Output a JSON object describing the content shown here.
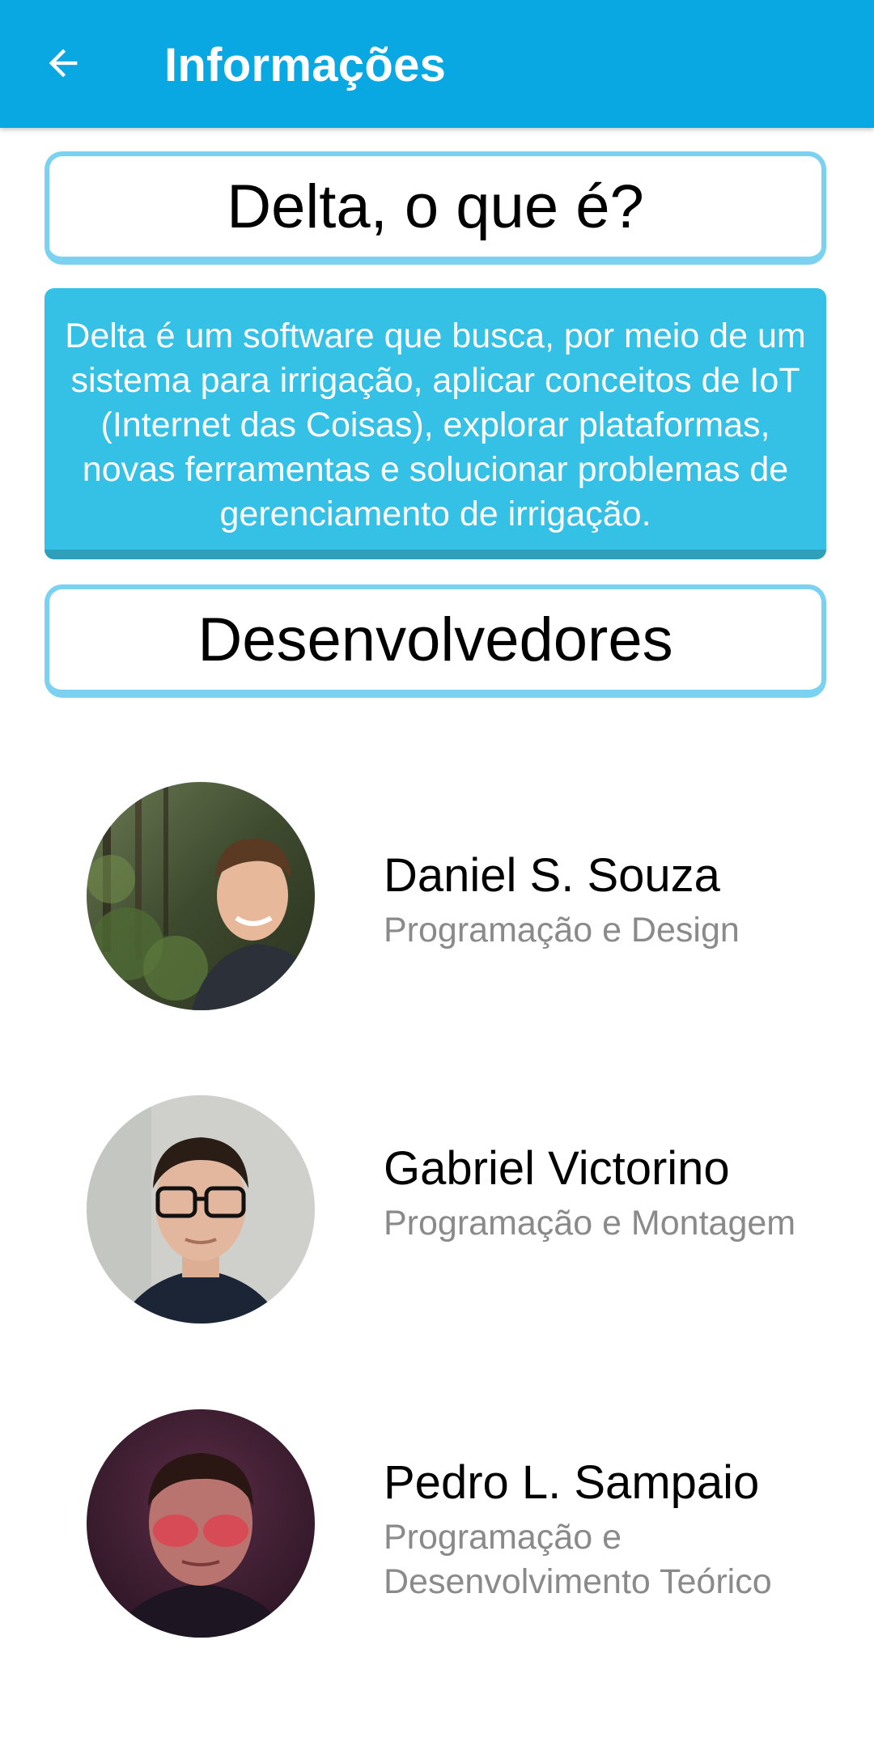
{
  "app_bar": {
    "title": "Informações",
    "back_icon": "arrow-left-icon",
    "color": "#0aa8e2"
  },
  "about": {
    "heading": "Delta, o que é?",
    "description": "Delta é um software que busca, por meio de um sistema para irrigação, aplicar conceitos de IoT (Internet das Coisas), explorar plataformas, novas ferramentas e solucionar problemas de gerenciamento de irrigação.",
    "card_color": "#35c0e6",
    "outline_color": "#7ad2f0"
  },
  "developers": {
    "heading": "Desenvolvedores",
    "items": [
      {
        "name": "Daniel S. Souza",
        "role": "Programação e Design"
      },
      {
        "name": "Gabriel Victorino",
        "role": "Programação e Montagem"
      },
      {
        "name": "Pedro L. Sampaio",
        "role": "Programação e Desenvolvimento Teórico"
      }
    ]
  }
}
